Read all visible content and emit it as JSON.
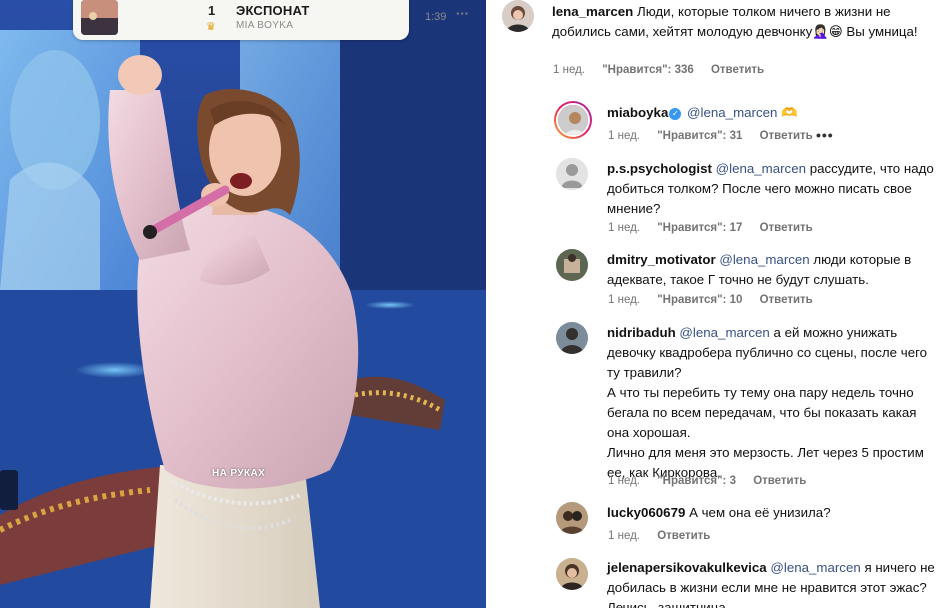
{
  "music": {
    "rank": "1",
    "title": "ЭКСПОНАТ",
    "artist": "MIA BOYKA",
    "duration": "1:39",
    "more": "···",
    "crown": "♛"
  },
  "video": {
    "caption": "НА РУКАХ"
  },
  "comments": [
    {
      "user": "lena_marcen",
      "text": "Люди, которые толком ничего в жизни не добились сами, хейтят молодую девчонку🤦🏻‍♀️😁 Вы умница!",
      "mention": "",
      "time": "1 нед.",
      "likes": "\"Нравится\": 336",
      "reply": "Ответить"
    },
    {
      "user": "miaboyka",
      "text": " 🫶",
      "mention": "@lena_marcen",
      "time": "1 нед.",
      "likes": "\"Нравится\": 31",
      "reply": "Ответить",
      "more": "•••"
    },
    {
      "user": "p.s.psychologist",
      "text": " рассудите, что надо добиться толком? После чего можно писать свое мнение?",
      "mention": "@lena_marcen",
      "time": "1 нед.",
      "likes": "\"Нравится\": 17",
      "reply": "Ответить"
    },
    {
      "user": "dmitry_motivator",
      "text": " люди которые в адеквате, такое Г точно не будут слушать.",
      "mention": "@lena_marcen",
      "time": "1 нед.",
      "likes": "\"Нравится\": 10",
      "reply": "Ответить"
    },
    {
      "user": "nidribaduh",
      "text": " а ей можно унижать девочку квадробера публично со сцены, после чего ту травили?",
      "text2": "А что ты перебить ту тему она пару недель точно бегала по всем передачам, что бы показать какая она хорошая.",
      "text3": "Лично для меня это мерзость. Лет через 5 простим ее, как Киркорова.",
      "mention": "@lena_marcen",
      "time": "1 нед.",
      "likes": "\"Нравится\": 3",
      "reply": "Ответить"
    },
    {
      "user": "lucky060679",
      "text": " А чем она её унизила?",
      "mention": "",
      "time": "1 нед.",
      "likes": "",
      "reply": "Ответить"
    },
    {
      "user": "jelenapersikovakulkevica",
      "text": " я ничего не добилась в жизни если мне не нравится этот эжас? Лечись, защитница.",
      "mention": "@lena_marcen",
      "time": "",
      "likes": "",
      "reply": ""
    }
  ],
  "colors": {
    "mention": "#385185",
    "meta": "#737373",
    "stage_blue": "#1f3f8a",
    "verified": "#3897f0"
  }
}
